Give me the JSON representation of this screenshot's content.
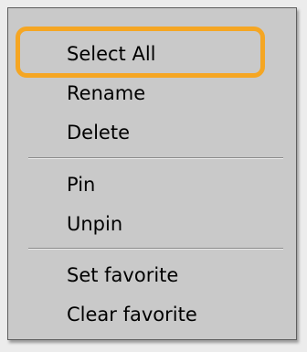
{
  "menu": {
    "items": [
      {
        "label": "Select All"
      },
      {
        "label": "Rename"
      },
      {
        "label": "Delete"
      },
      {
        "label": "Pin"
      },
      {
        "label": "Unpin"
      },
      {
        "label": "Set favorite"
      },
      {
        "label": "Clear favorite"
      }
    ]
  },
  "colors": {
    "menu_background": "#c9c9c9",
    "highlight": "#f5a623"
  }
}
